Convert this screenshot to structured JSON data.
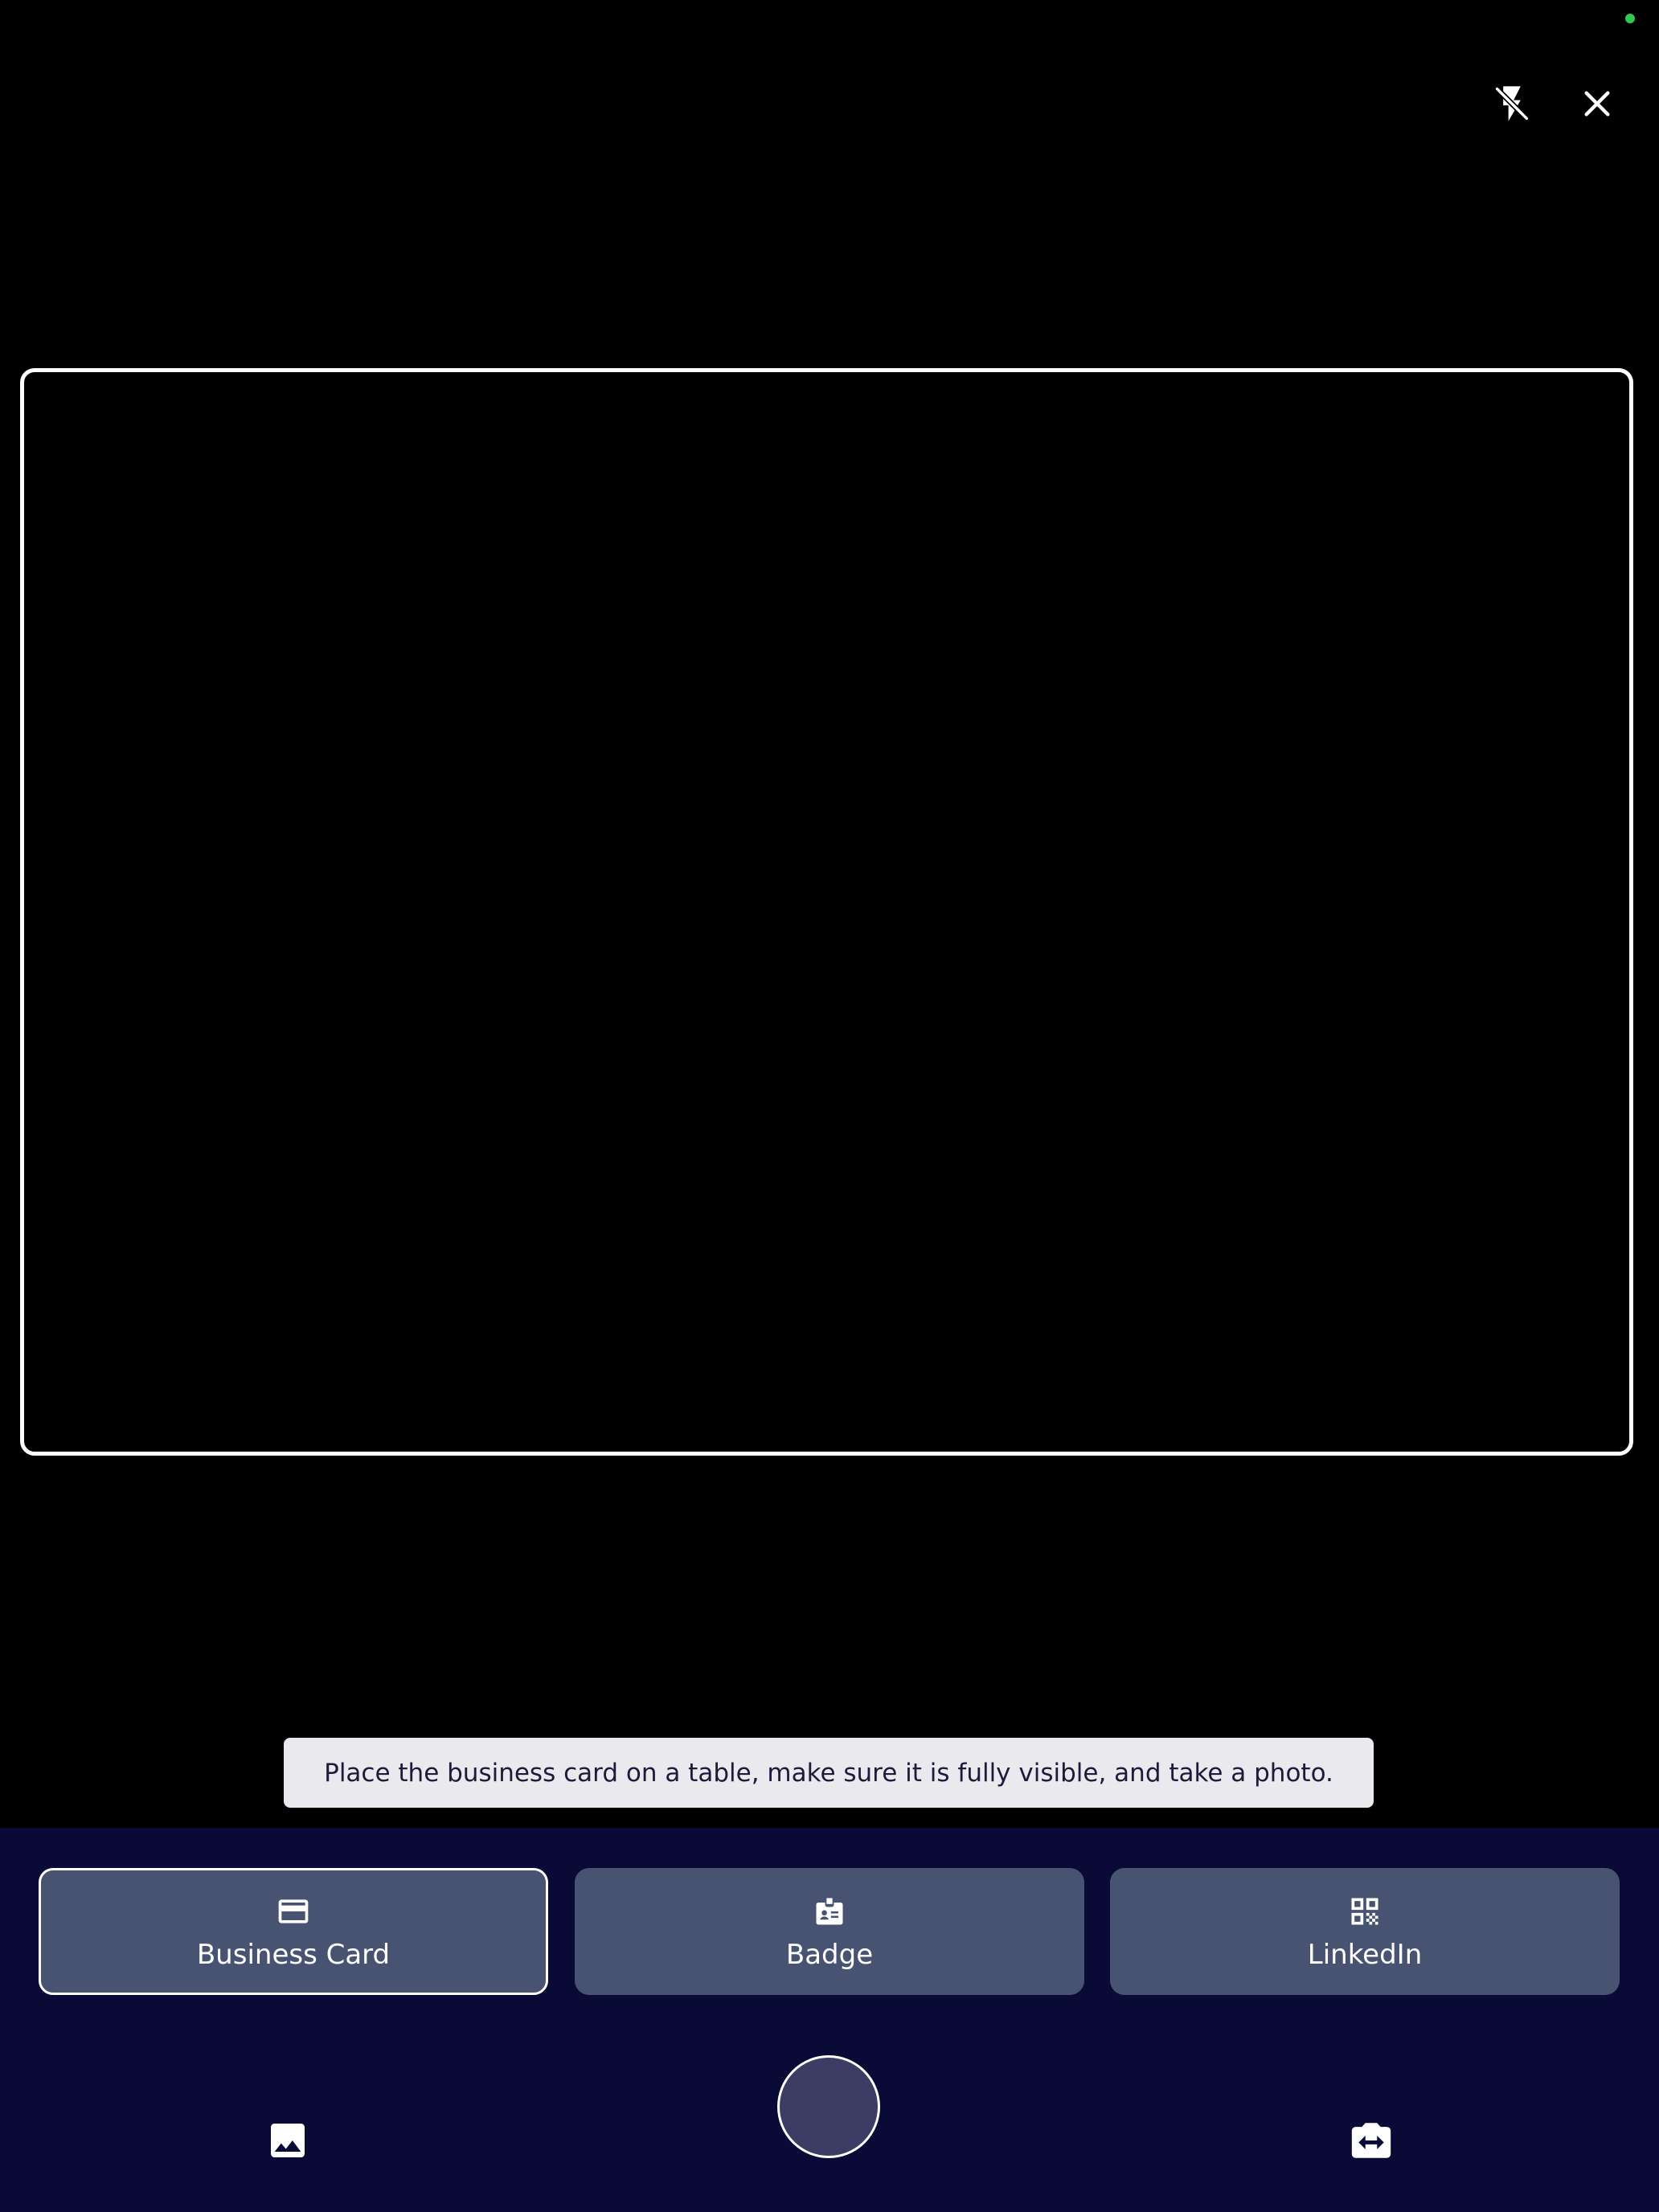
{
  "topbar": {
    "flash_icon": "flash-off-icon",
    "close_icon": "close-icon",
    "status_indicator_color": "#2fc94e"
  },
  "viewfinder": {
    "frame_color": "#ffffff"
  },
  "hint": {
    "text": "Place the business card on a table, make sure it is fully visible, and take a photo."
  },
  "modes": [
    {
      "label": "Business Card",
      "icon": "credit-card-icon",
      "selected": true
    },
    {
      "label": "Badge",
      "icon": "badge-icon",
      "selected": false
    },
    {
      "label": "LinkedIn",
      "icon": "qr-code-icon",
      "selected": false
    }
  ],
  "controls": {
    "gallery_icon": "image-icon",
    "shutter_icon": "shutter-button",
    "switch_camera_icon": "camera-switch-icon"
  },
  "colors": {
    "background": "#000000",
    "panel": "#0a0a37",
    "mode_button": "#485371",
    "shutter": "#3c3c64",
    "hint_background": "#e9e9ee",
    "hint_text": "#1c1c3a"
  }
}
